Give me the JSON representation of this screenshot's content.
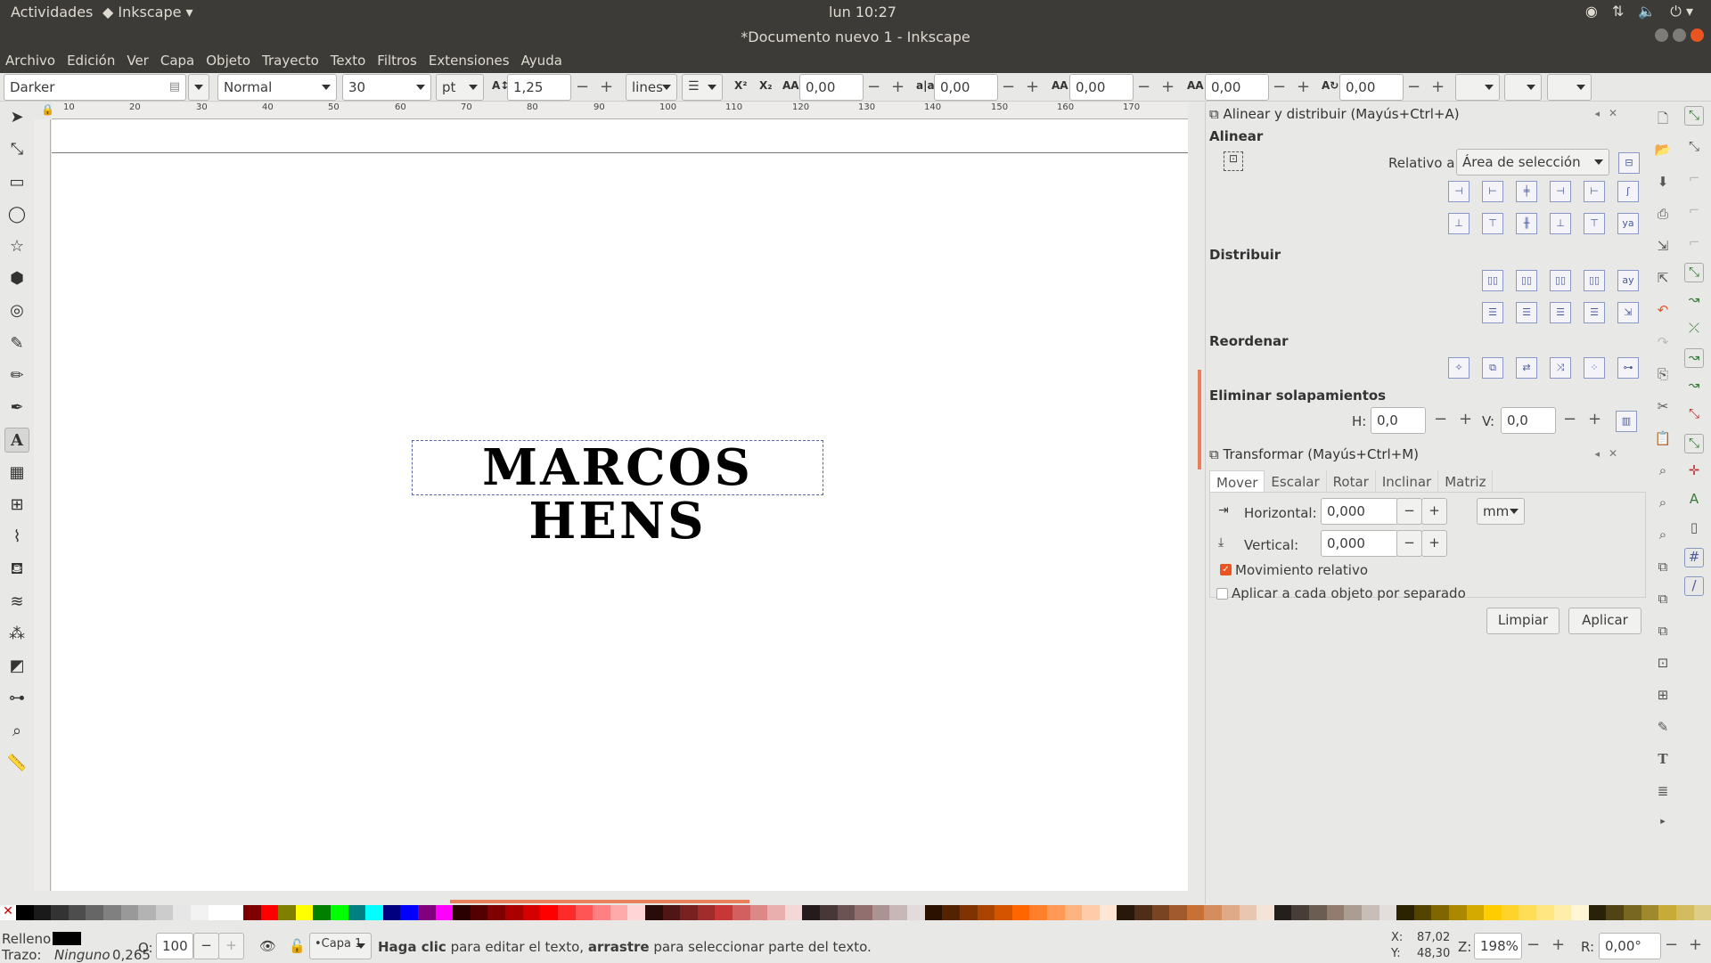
{
  "topbar": {
    "activities": "Actividades",
    "app": "Inkscape",
    "clock": "lun 10:27"
  },
  "window": {
    "title": "*Documento nuevo 1 - Inkscape"
  },
  "menu": [
    "Archivo",
    "Edición",
    "Ver",
    "Capa",
    "Objeto",
    "Trayecto",
    "Texto",
    "Filtros",
    "Extensiones",
    "Ayuda"
  ],
  "text_toolbar": {
    "font_family": "Darker",
    "font_style": "Normal",
    "font_size": "30",
    "unit": "pt",
    "line_spacing": "1,25",
    "spacing_mode": "lines",
    "letter_spacing": "0,00",
    "word_spacing": "0,00",
    "kerning_h": "0,00",
    "kerning_v": "0,00",
    "rotation": "0,00"
  },
  "ruler": {
    "h_ticks": [
      "10",
      "20",
      "30",
      "40",
      "50",
      "60",
      "70",
      "80",
      "90",
      "100",
      "110",
      "120",
      "130",
      "140",
      "150",
      "160",
      "170"
    ]
  },
  "canvas": {
    "text": "MARCOS HENS"
  },
  "align_panel": {
    "title": "Alinear y distribuir (Mayús+Ctrl+A)",
    "align_label": "Alinear",
    "relative_label": "Relativo a:",
    "relative_value": "Área de selección",
    "distribute_label": "Distribuir",
    "reorder_label": "Reordenar",
    "overlap_label": "Eliminar solapamientos",
    "h_label": "H:",
    "h_value": "0,0",
    "v_label": "V:",
    "v_value": "0,0"
  },
  "transform_panel": {
    "title": "Transformar (Mayús+Ctrl+M)",
    "tabs": [
      "Mover",
      "Escalar",
      "Rotar",
      "Inclinar",
      "Matriz"
    ],
    "horizontal_label": "Horizontal:",
    "horizontal_value": "0,000",
    "vertical_label": "Vertical:",
    "vertical_value": "0,000",
    "unit": "mm",
    "relative_move": "Movimiento relativo",
    "apply_each": "Aplicar a cada objeto por separado",
    "clear_button": "Limpiar",
    "apply_button": "Aplicar"
  },
  "status": {
    "fill_label": "Relleno:",
    "stroke_label": "Trazo:",
    "stroke_value": "Ninguno",
    "stroke_width": "0,265",
    "opacity_label": "O:",
    "opacity_value": "100",
    "layer": "•Capa 1",
    "msg_bold1": "Haga clic",
    "msg_1": " para editar el texto, ",
    "msg_bold2": "arrastre",
    "msg_2": " para seleccionar parte del texto.",
    "x_label": "X:",
    "x_value": "87,02",
    "y_label": "Y:",
    "y_value": "48,30",
    "zoom_label": "Z:",
    "zoom_value": "198%",
    "rot_label": "R:",
    "rot_value": "0,00°"
  },
  "palette": [
    "#000000",
    "#1a1a1a",
    "#333333",
    "#4d4d4d",
    "#666666",
    "#808080",
    "#999999",
    "#b3b3b3",
    "#cccccc",
    "#e6e6e6",
    "#f2f2f2",
    "#ffffff",
    "#ffffff",
    "#800000",
    "#ff0000",
    "#808000",
    "#ffff00",
    "#008000",
    "#00ff00",
    "#008080",
    "#00ffff",
    "#000080",
    "#0000ff",
    "#800080",
    "#ff00ff",
    "#2b0000",
    "#550000",
    "#800000",
    "#aa0000",
    "#d40000",
    "#ff0000",
    "#ff2a2a",
    "#ff5555",
    "#ff8080",
    "#ffaaaa",
    "#ffd5d5",
    "#280b0b",
    "#501616",
    "#782121",
    "#a02c2c",
    "#c83737",
    "#d35f5f",
    "#de8787",
    "#e9afaf",
    "#f4d7d7",
    "#241c1c",
    "#483737",
    "#6c5353",
    "#916f6f",
    "#ac9393",
    "#c8b7b7",
    "#e3dbdb",
    "#2b1100",
    "#552200",
    "#803300",
    "#aa4400",
    "#d45500",
    "#ff6600",
    "#ff7f2a",
    "#ff9955",
    "#ffb380",
    "#ffccaa",
    "#ffe6d5",
    "#28170b",
    "#502d16",
    "#784421",
    "#a05a2c",
    "#c87137",
    "#d38d5f",
    "#deaa87",
    "#e9c6af",
    "#f4e3d7",
    "#241f1c",
    "#483e37",
    "#6c5d53",
    "#917c6f",
    "#ac9d93",
    "#c8beb7",
    "#e3dedb",
    "#2b2200",
    "#554400",
    "#806600",
    "#aa8800",
    "#d4aa00",
    "#ffcc00",
    "#ffd42a",
    "#ffdd55",
    "#ffe680",
    "#ffeeaa",
    "#fff6d5",
    "#28220b",
    "#504416",
    "#786721",
    "#a0892c",
    "#c8ab37",
    "#d3bc5f",
    "#decd87"
  ]
}
